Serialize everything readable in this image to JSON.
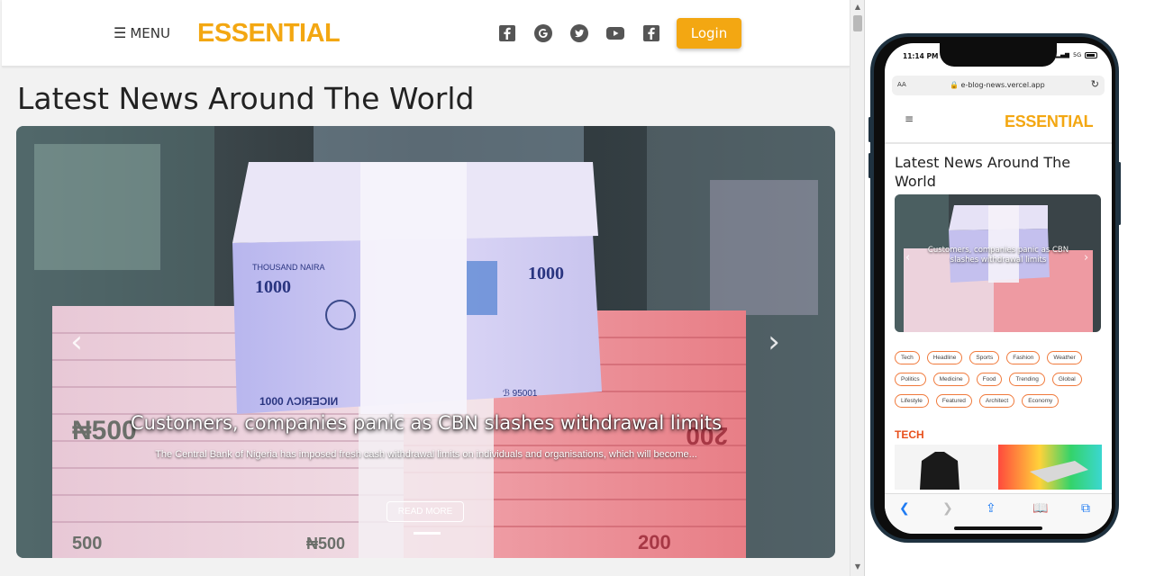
{
  "brand": {
    "logo": "ESSENTIAL",
    "accent": "#f3a712"
  },
  "desktop": {
    "header": {
      "menu_label": "MENU",
      "menu_icon": "☰",
      "social_icons": [
        "facebook-icon",
        "google-icon",
        "twitter-icon",
        "youtube-icon",
        "facebook-icon"
      ],
      "login_label": "Login"
    },
    "page_title": "Latest News Around The World",
    "hero": {
      "headline": "Customers, companies panic as CBN slashes withdrawal limits",
      "summary": "The Central Bank of Nigeria has imposed fresh cash withdrawal limits on individuals and organisations, which will become...",
      "read_more": "READ MORE",
      "prev": "‹",
      "next": "›"
    }
  },
  "phone": {
    "status_time": "11:14 PM",
    "status_network": "5G",
    "url_aa": "AA",
    "url": "e-blog-news.vercel.app",
    "menu_icon": "≡",
    "page_title": "Latest News Around The World",
    "hero_headline": "Customers, companies panic as CBN slashes withdrawal limits",
    "tags": [
      "Tech",
      "Headline",
      "Sports",
      "Fashion",
      "Weather",
      "Politics",
      "Medicine",
      "Food",
      "Trending",
      "Global",
      "Lifestyle",
      "Featured",
      "Architect",
      "Economy"
    ],
    "section_label": "TECH",
    "section_color": "#e8501c",
    "tag_border": "#f07a3c"
  }
}
